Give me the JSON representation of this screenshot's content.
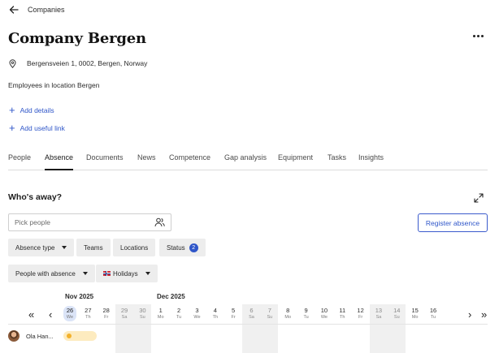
{
  "breadcrumb": {
    "label": "Companies"
  },
  "company": {
    "title": "Company Bergen",
    "address": "Bergensveien 1, 0002, Bergen, Norway",
    "description": "Employees in location Bergen"
  },
  "links": {
    "add_details": "Add details",
    "add_useful_link": "Add useful link"
  },
  "tabs": [
    "People",
    "Absence",
    "Documents",
    "News",
    "Competence",
    "Gap analysis",
    "Equipment",
    "Tasks",
    "Insights"
  ],
  "active_tab": "Absence",
  "absence": {
    "title": "Who's away?",
    "pick_placeholder": "Pick people",
    "register_label": "Register absence",
    "filters": {
      "absence_type": "Absence type",
      "teams": "Teams",
      "locations": "Locations",
      "status": "Status",
      "status_count": "2",
      "people_with_absence": "People with absence",
      "holidays": "Holidays"
    },
    "months": {
      "first": "Nov 2025",
      "second": "Dec 2025"
    },
    "days": [
      {
        "num": "26",
        "dow": "We"
      },
      {
        "num": "27",
        "dow": "Th"
      },
      {
        "num": "28",
        "dow": "Fr"
      },
      {
        "num": "29",
        "dow": "Sa"
      },
      {
        "num": "30",
        "dow": "Su"
      },
      {
        "num": "1",
        "dow": "Mo"
      },
      {
        "num": "2",
        "dow": "Tu"
      },
      {
        "num": "3",
        "dow": "We"
      },
      {
        "num": "4",
        "dow": "Th"
      },
      {
        "num": "5",
        "dow": "Fr"
      },
      {
        "num": "6",
        "dow": "Sa"
      },
      {
        "num": "7",
        "dow": "Su"
      },
      {
        "num": "8",
        "dow": "Mo"
      },
      {
        "num": "9",
        "dow": "Tu"
      },
      {
        "num": "10",
        "dow": "We"
      },
      {
        "num": "11",
        "dow": "Th"
      },
      {
        "num": "12",
        "dow": "Fr"
      },
      {
        "num": "13",
        "dow": "Sa"
      },
      {
        "num": "14",
        "dow": "Su"
      },
      {
        "num": "15",
        "dow": "Mo"
      },
      {
        "num": "16",
        "dow": "Tu"
      }
    ],
    "today": "26",
    "employee": {
      "name": "Ola Han..."
    }
  },
  "colors": {
    "accent": "#2f56c9",
    "weekend": "#f0f0f0",
    "absence": "#fdebbf",
    "absence_dot": "#f3b12b"
  }
}
